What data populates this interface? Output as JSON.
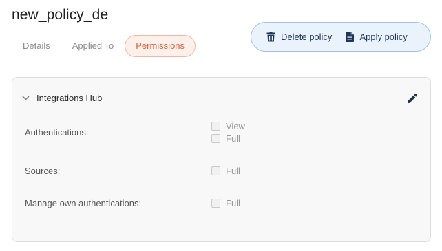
{
  "policy": {
    "name": "new_policy_de"
  },
  "tabs": [
    {
      "label": "Details"
    },
    {
      "label": "Applied To"
    },
    {
      "label": "Permissions"
    }
  ],
  "actions": {
    "delete_label": "Delete policy",
    "apply_label": "Apply policy"
  },
  "permissions_card": {
    "title": "Integrations Hub",
    "rows": [
      {
        "label": "Authentications:",
        "options": [
          "View",
          "Full"
        ]
      },
      {
        "label": "Sources:",
        "options": [
          "Full"
        ]
      },
      {
        "label": "Manage own authentications:",
        "options": [
          "Full"
        ]
      }
    ]
  },
  "colors": {
    "active_tab": "#d7613b",
    "action_bar_bg": "#eaf3fb",
    "action_text": "#1d3557",
    "edit_icon": "#1d3557"
  },
  "icons": {
    "delete": "trash-icon",
    "apply": "document-icon",
    "collapse": "chevron-down-icon",
    "edit": "pencil-icon"
  }
}
